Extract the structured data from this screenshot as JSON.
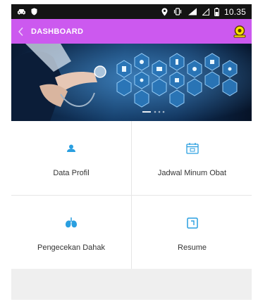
{
  "status_bar": {
    "time": "10.35",
    "left_icons": [
      "car-icon",
      "shield-icon"
    ],
    "right_icons": [
      "location-icon",
      "vibrate-icon",
      "signal-icon",
      "signal-icon",
      "battery-icon"
    ]
  },
  "app_bar": {
    "title": "DASHBOARD",
    "background": "#cc59ef"
  },
  "banner": {
    "image": "doctor-with-stethoscope-and-medical-hexagon-icons"
  },
  "menu": {
    "items": [
      {
        "label": "Data Profil",
        "icon": "user-icon"
      },
      {
        "label": "Jadwal Minum Obat",
        "icon": "calendar-icon"
      },
      {
        "label": "Pengecekan Dahak",
        "icon": "lungs-icon"
      },
      {
        "label": "Resume",
        "icon": "document-icon"
      }
    ]
  },
  "colors": {
    "accent": "#cc59ef",
    "icon_blue": "#2a9fe0"
  }
}
